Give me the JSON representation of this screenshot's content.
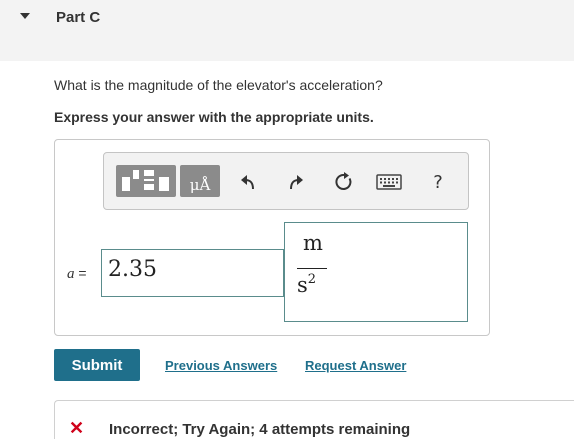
{
  "part": {
    "title": "Part C"
  },
  "question": {
    "text": "What is the magnitude of the elevator's acceleration?",
    "instruction": "Express your answer with the appropriate units."
  },
  "toolbar": {
    "units_label": "μÅ",
    "help_label": "?",
    "icons": [
      "templates-icon",
      "units-icon",
      "undo-icon",
      "redo-icon",
      "reset-icon",
      "keyboard-icon",
      "help-icon"
    ]
  },
  "answer": {
    "variable": "a",
    "equals": "=",
    "value": "2.35",
    "unit_numerator": "m",
    "unit_denominator": "s",
    "unit_exponent": "2"
  },
  "actions": {
    "submit_label": "Submit",
    "previous_answers_label": "Previous Answers",
    "request_answer_label": "Request Answer"
  },
  "feedback": {
    "text": "Incorrect; Try Again; 4 attempts remaining",
    "icon": "x-icon",
    "color": "#d0021b"
  },
  "colors": {
    "accent": "#1f6f8b",
    "toolbar_button": "#8b8b8b",
    "input_border": "#5a8c8c"
  }
}
